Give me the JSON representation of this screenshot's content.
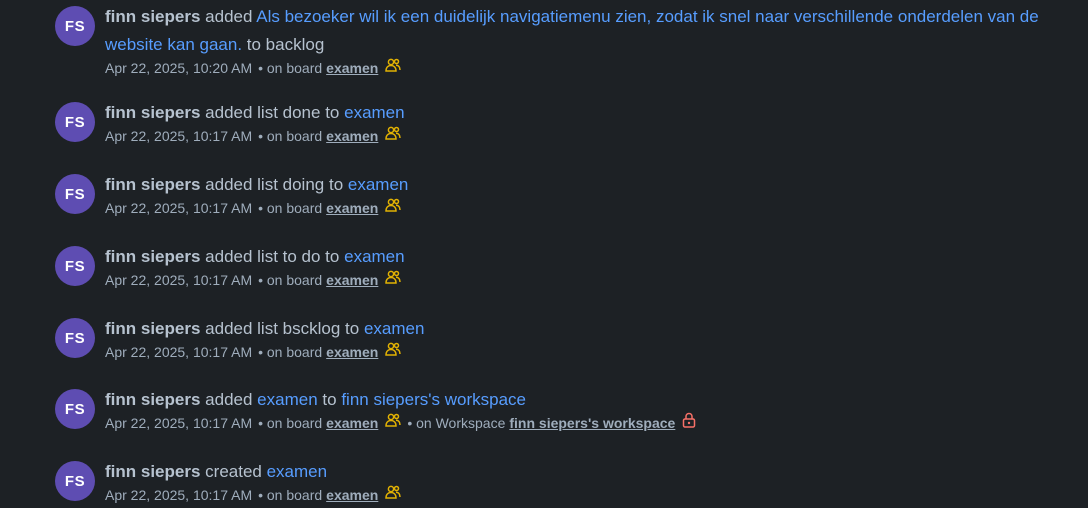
{
  "colors": {
    "background": "#1d2125",
    "avatar": "#5e4db2",
    "link": "#579dff",
    "text": "#b6c2cf",
    "meta": "#9fadbc",
    "public_icon": "#e2b203",
    "lock_icon": "#f87168"
  },
  "icons": {
    "visibility": "public-people-icon",
    "workspace_private": "lock-icon"
  },
  "feed": [
    {
      "avatar": "FS",
      "user": "finn siepers",
      "verb": "added",
      "target": "Als bezoeker wil ik een duidelijk navigatiemenu zien, zodat ik snel naar verschillende onderdelen van de website kan gaan.",
      "connector": "to backlog",
      "timestamp": "Apr 22, 2025, 10:20 AM",
      "board_prefix": "• on board",
      "board": "examen"
    },
    {
      "avatar": "FS",
      "user": "finn siepers",
      "verb": "added list done to",
      "target": "examen",
      "timestamp": "Apr 22, 2025, 10:17 AM",
      "board_prefix": "• on board",
      "board": "examen"
    },
    {
      "avatar": "FS",
      "user": "finn siepers",
      "verb": "added list doing to",
      "target": "examen",
      "timestamp": "Apr 22, 2025, 10:17 AM",
      "board_prefix": "• on board",
      "board": "examen"
    },
    {
      "avatar": "FS",
      "user": "finn siepers",
      "verb": "added list to do to",
      "target": "examen",
      "timestamp": "Apr 22, 2025, 10:17 AM",
      "board_prefix": "• on board",
      "board": "examen"
    },
    {
      "avatar": "FS",
      "user": "finn siepers",
      "verb": "added list bscklog to",
      "target": "examen",
      "timestamp": "Apr 22, 2025, 10:17 AM",
      "board_prefix": "• on board",
      "board": "examen"
    },
    {
      "avatar": "FS",
      "user": "finn siepers",
      "verb": "added",
      "target": "examen",
      "connector": "to",
      "target2": "finn siepers's workspace",
      "timestamp": "Apr 22, 2025, 10:17 AM",
      "board_prefix": "• on board",
      "board": "examen",
      "workspace_prefix": "• on Workspace",
      "workspace": "finn siepers's workspace"
    },
    {
      "avatar": "FS",
      "user": "finn siepers",
      "verb": "created",
      "target": "examen",
      "timestamp": "Apr 22, 2025, 10:17 AM",
      "board_prefix": "• on board",
      "board": "examen"
    }
  ]
}
